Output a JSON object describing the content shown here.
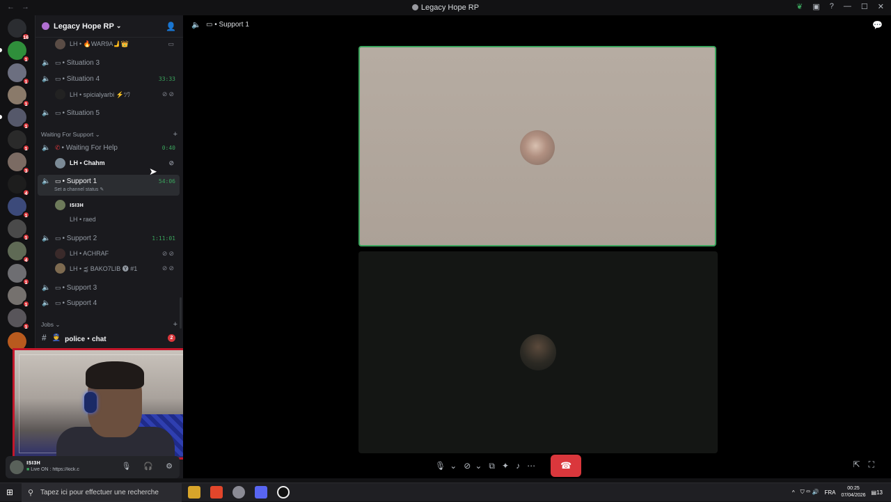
{
  "window": {
    "title": "Legacy Hope RP"
  },
  "server": {
    "name": "Legacy Hope RP"
  },
  "guild_badges": [
    "16",
    "1",
    "1",
    "1",
    "1",
    "1",
    "1",
    "3",
    "4",
    "1",
    "1",
    "1",
    "4",
    "1",
    "1",
    "1",
    "1"
  ],
  "channels": {
    "top_user": "LH • 🔥WAR9A🫸👑",
    "situation3": "• Situation 3",
    "situation4": "• Situation 4",
    "situation4_timer": "33:33",
    "situation4_user": "LH • spicialyarbi ⚡ﾂﾜ",
    "situation5": "• Situation 5",
    "cat_waiting": "Waiting For Support ⌄",
    "waiting": "• Waiting For Help",
    "waiting_timer": "0:40",
    "waiting_user": "LH • Chahm",
    "support1": "• Support 1",
    "support1_timer": "54:06",
    "support1_status": "Set a channel status ✎",
    "support1_user1": "ısıзн",
    "support1_user2": "LH • raed",
    "support2": "• Support 2",
    "support2_timer": "1:11:01",
    "support2_user1": "LH • ACHRAF",
    "support2_user2": "LH • ⪷ BAKO7LIB 🅨 #1",
    "support3": "• Support 3",
    "support4": "• Support 4",
    "cat_jobs": "Jobs ⌄",
    "police_chat": "police・chat",
    "police_count": "2"
  },
  "user_panel": {
    "name": "ısıзн",
    "status_prefix": "Live ON :",
    "status_text": " https://kick.c"
  },
  "main": {
    "header": "• Support 1"
  },
  "taskbar": {
    "search_placeholder": "Tapez ici pour effectuer une recherche",
    "lang": "FRA",
    "time": "00:25",
    "date": "07/04/2026",
    "notif": "13"
  }
}
